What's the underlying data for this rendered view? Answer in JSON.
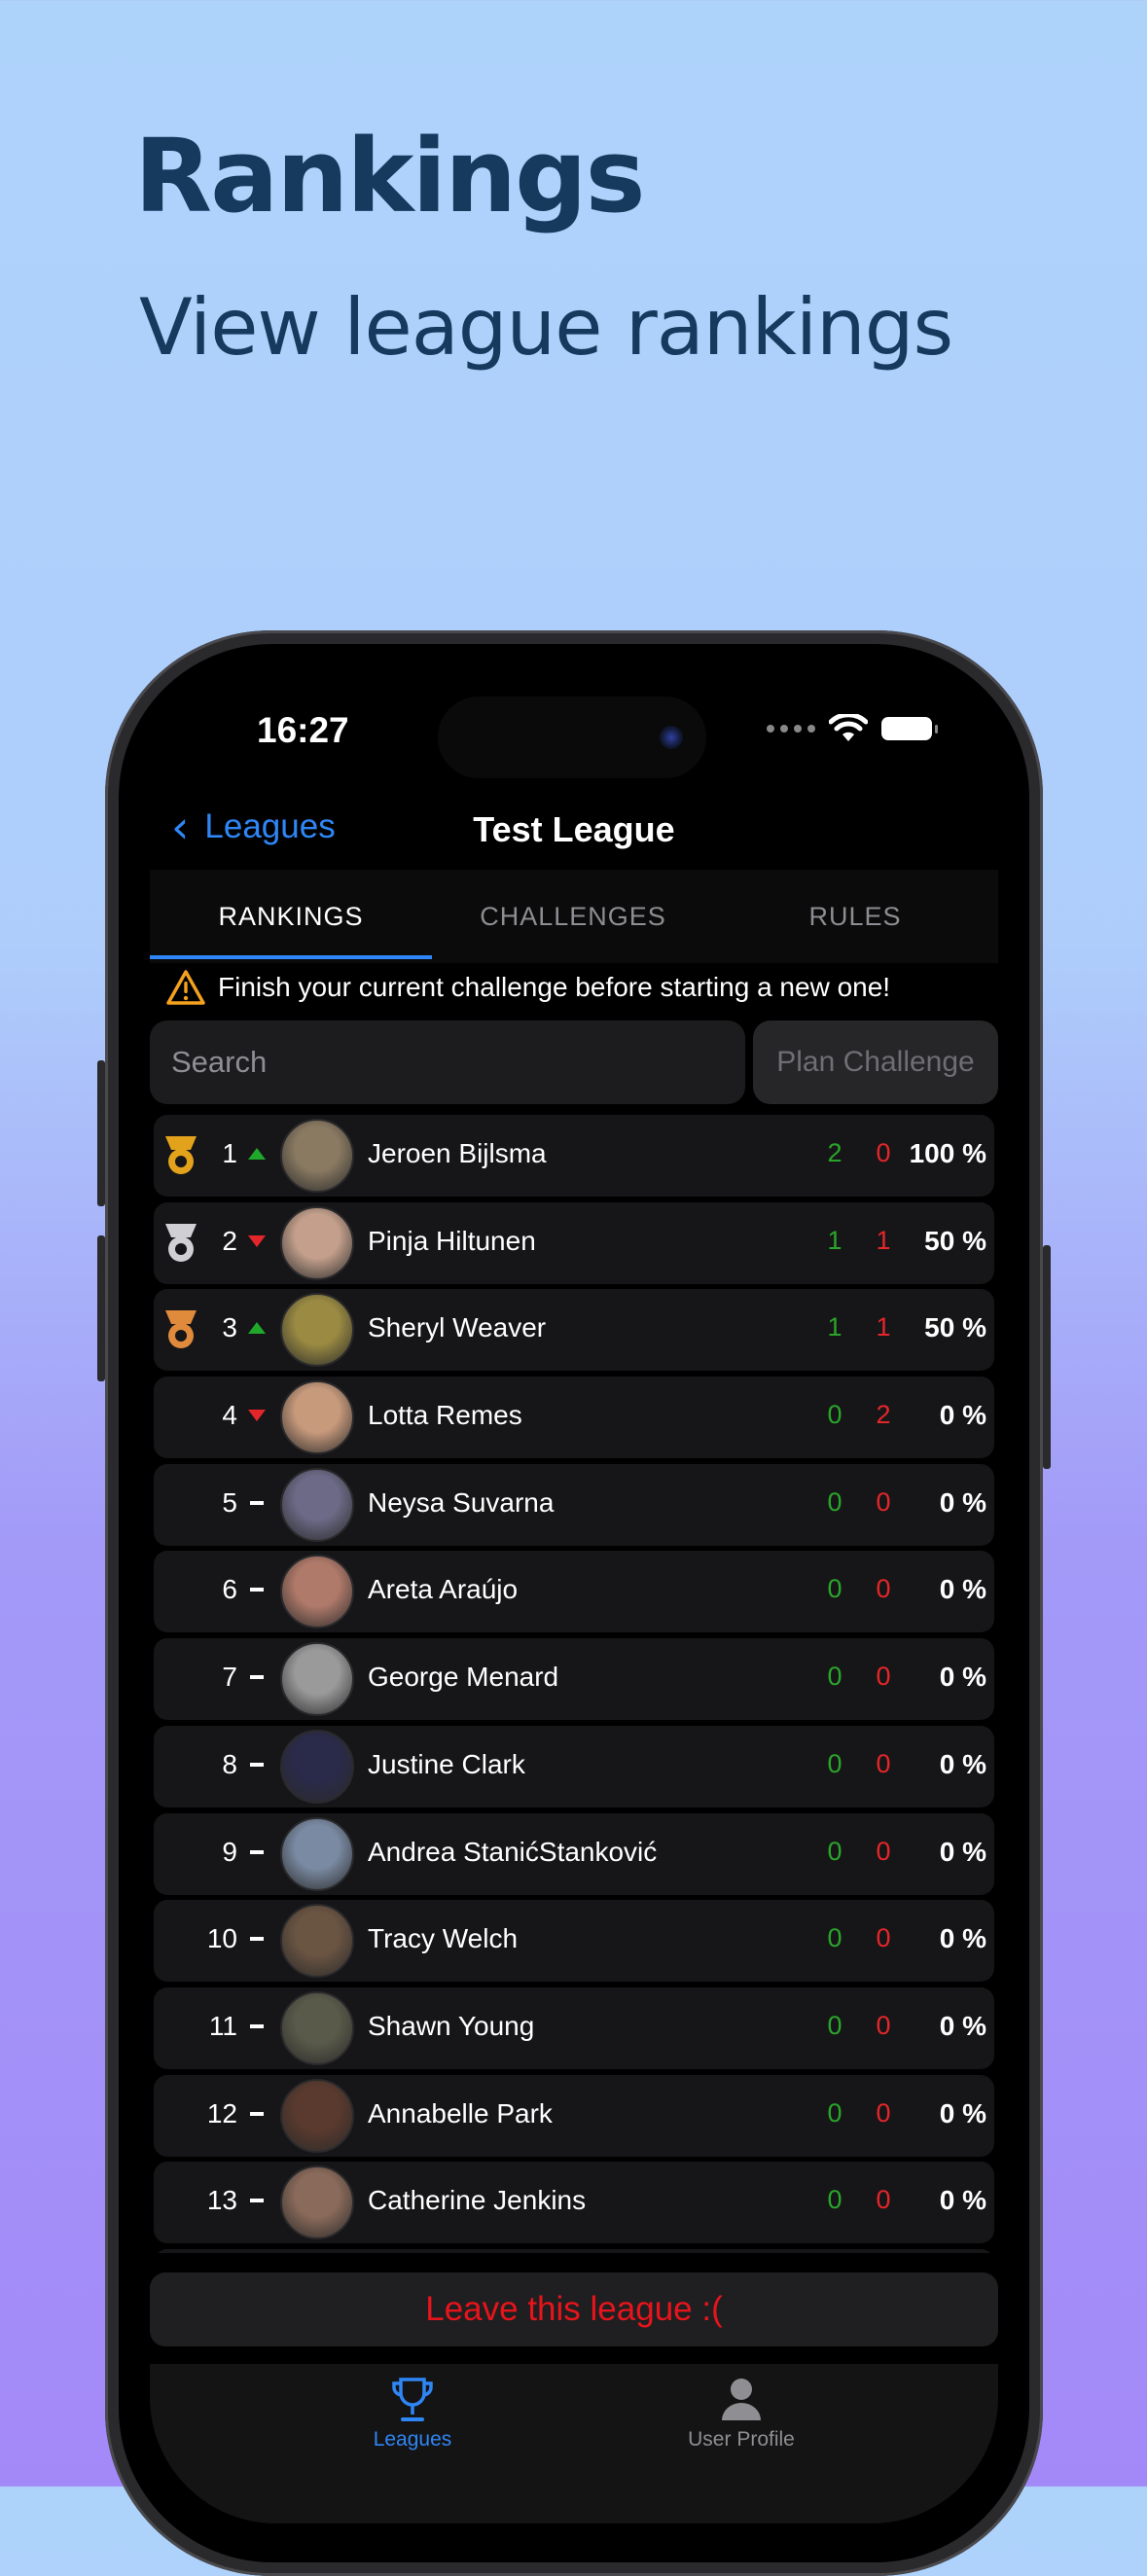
{
  "promo": {
    "title": "Rankings",
    "subtitle": "View league rankings"
  },
  "status_bar": {
    "time": "16:27"
  },
  "nav": {
    "back_label": "Leagues",
    "title": "Test League"
  },
  "tabs": [
    {
      "label": "RANKINGS",
      "active": true
    },
    {
      "label": "CHALLENGES",
      "active": false
    },
    {
      "label": "RULES",
      "active": false
    }
  ],
  "warning": {
    "text": "Finish your current challenge before starting a new one!",
    "icon": "warning-triangle-icon"
  },
  "search": {
    "placeholder": "Search"
  },
  "plan_challenge": {
    "label": "Plan Challenge"
  },
  "rankings": [
    {
      "rank": "1",
      "trend": "up",
      "medal": "gold",
      "name": "Jeroen Bijlsma",
      "wins": "2",
      "losses": "0",
      "pct": "100 %",
      "avatar": "#8a7a62"
    },
    {
      "rank": "2",
      "trend": "down",
      "medal": "silver",
      "name": "Pinja Hiltunen",
      "wins": "1",
      "losses": "1",
      "pct": "50 %",
      "avatar": "#c4a08c"
    },
    {
      "rank": "3",
      "trend": "up",
      "medal": "bronze",
      "name": "Sheryl Weaver",
      "wins": "1",
      "losses": "1",
      "pct": "50 %",
      "avatar": "#9a8a42"
    },
    {
      "rank": "4",
      "trend": "down",
      "medal": "",
      "name": "Lotta Remes",
      "wins": "0",
      "losses": "2",
      "pct": "0 %",
      "avatar": "#c89a7c"
    },
    {
      "rank": "5",
      "trend": "same",
      "medal": "",
      "name": "Neysa Suvarna",
      "wins": "0",
      "losses": "0",
      "pct": "0 %",
      "avatar": "#6c6a86"
    },
    {
      "rank": "6",
      "trend": "same",
      "medal": "",
      "name": "Areta Araújo",
      "wins": "0",
      "losses": "0",
      "pct": "0 %",
      "avatar": "#b07a6a"
    },
    {
      "rank": "7",
      "trend": "same",
      "medal": "",
      "name": "George Menard",
      "wins": "0",
      "losses": "0",
      "pct": "0 %",
      "avatar": "#9a9a9a"
    },
    {
      "rank": "8",
      "trend": "same",
      "medal": "",
      "name": "Justine Clark",
      "wins": "0",
      "losses": "0",
      "pct": "0 %",
      "avatar": "#2a2a4a"
    },
    {
      "rank": "9",
      "trend": "same",
      "medal": "",
      "name": "Andrea StanićStanković",
      "wins": "0",
      "losses": "0",
      "pct": "0 %",
      "avatar": "#7a8aa2"
    },
    {
      "rank": "10",
      "trend": "same",
      "medal": "",
      "name": "Tracy Welch",
      "wins": "0",
      "losses": "0",
      "pct": "0 %",
      "avatar": "#6a5442"
    },
    {
      "rank": "11",
      "trend": "same",
      "medal": "",
      "name": "Shawn Young",
      "wins": "0",
      "losses": "0",
      "pct": "0 %",
      "avatar": "#5a5a4a"
    },
    {
      "rank": "12",
      "trend": "same",
      "medal": "",
      "name": "Annabelle Park",
      "wins": "0",
      "losses": "0",
      "pct": "0 %",
      "avatar": "#5a3a2e"
    },
    {
      "rank": "13",
      "trend": "same",
      "medal": "",
      "name": "Catherine Jenkins",
      "wins": "0",
      "losses": "0",
      "pct": "0 %",
      "avatar": "#8a6a5a"
    }
  ],
  "leave_button": {
    "label": "Leave this league :("
  },
  "tab_bar": [
    {
      "label": "Leagues",
      "icon": "trophy-icon",
      "active": true
    },
    {
      "label": "User Profile",
      "icon": "user-profile-icon",
      "active": false
    }
  ],
  "colors": {
    "accent": "#2f86f6",
    "win": "#2aa52a",
    "loss": "#e4262a",
    "leave": "#e7141b"
  }
}
